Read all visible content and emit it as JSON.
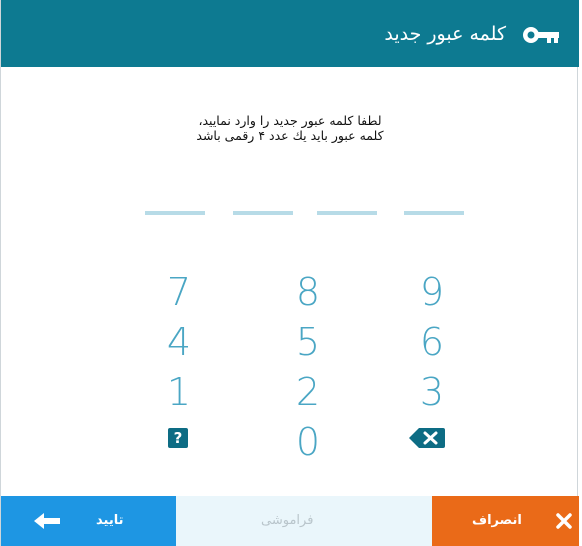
{
  "header": {
    "title": "کلمه عبور جدید",
    "icon": "key-icon",
    "color": "#0d7a91"
  },
  "instructions": {
    "line1": "لطفا کلمه عبور جدید را وارد نمایید،",
    "line2": "کلمه عبور باید یك عدد ۴ رقمی باشد"
  },
  "pin": {
    "slots": 4,
    "entered": 0
  },
  "keypad": {
    "keys": [
      "7",
      "8",
      "9",
      "4",
      "5",
      "6",
      "1",
      "2",
      "3",
      "0"
    ],
    "help_icon": "question-mark-icon",
    "backspace_icon": "backspace-icon",
    "color": "#4aa6c4"
  },
  "footer": {
    "ok_label": "تایید",
    "forgot_label": "فراموشی",
    "cancel_label": "انصراف",
    "ok_color": "#1e96e3",
    "cancel_color": "#ea6a18"
  }
}
